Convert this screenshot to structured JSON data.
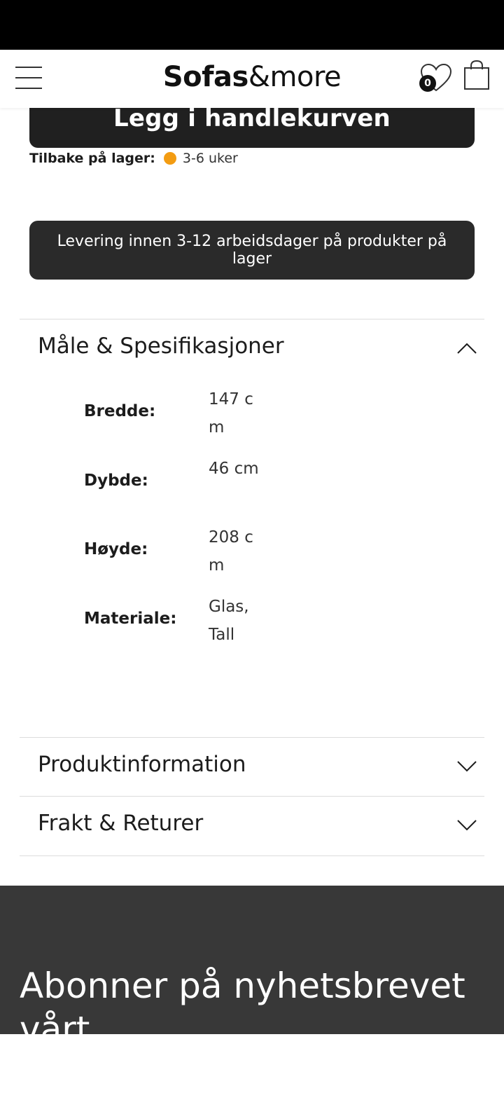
{
  "header": {
    "logo_bold": "Sofas",
    "logo_light": "&more",
    "wishlist_count": "0"
  },
  "product": {
    "add_to_cart": "Legg i handlekurven",
    "stock_label": "Tilbake på lager:",
    "stock_value": "3-6 uker",
    "stock_color": "#f39c12",
    "delivery_note": "Levering innen 3-12 arbeidsdager på produkter på lager"
  },
  "accordions": {
    "specs": {
      "title": "Måle & Spesifikasjoner",
      "state": "expanded",
      "rows": [
        {
          "label": "Bredde:",
          "value": "147 cm"
        },
        {
          "label": "Dybde:",
          "value": "46 cm"
        },
        {
          "label": "Høyde:",
          "value": "208 cm"
        },
        {
          "label": "Materiale:",
          "value": "Glas, Tall"
        }
      ]
    },
    "info": {
      "title": "Produktinformation",
      "state": "collapsed"
    },
    "shipping": {
      "title": "Frakt & Returer",
      "state": "collapsed"
    }
  },
  "newsletter": {
    "title": "Abonner på nyhetsbrevet vårt"
  },
  "icons": [
    "menu-icon",
    "heart-icon",
    "shopping-bag-icon",
    "chevron-up-icon",
    "chevron-down-icon"
  ]
}
